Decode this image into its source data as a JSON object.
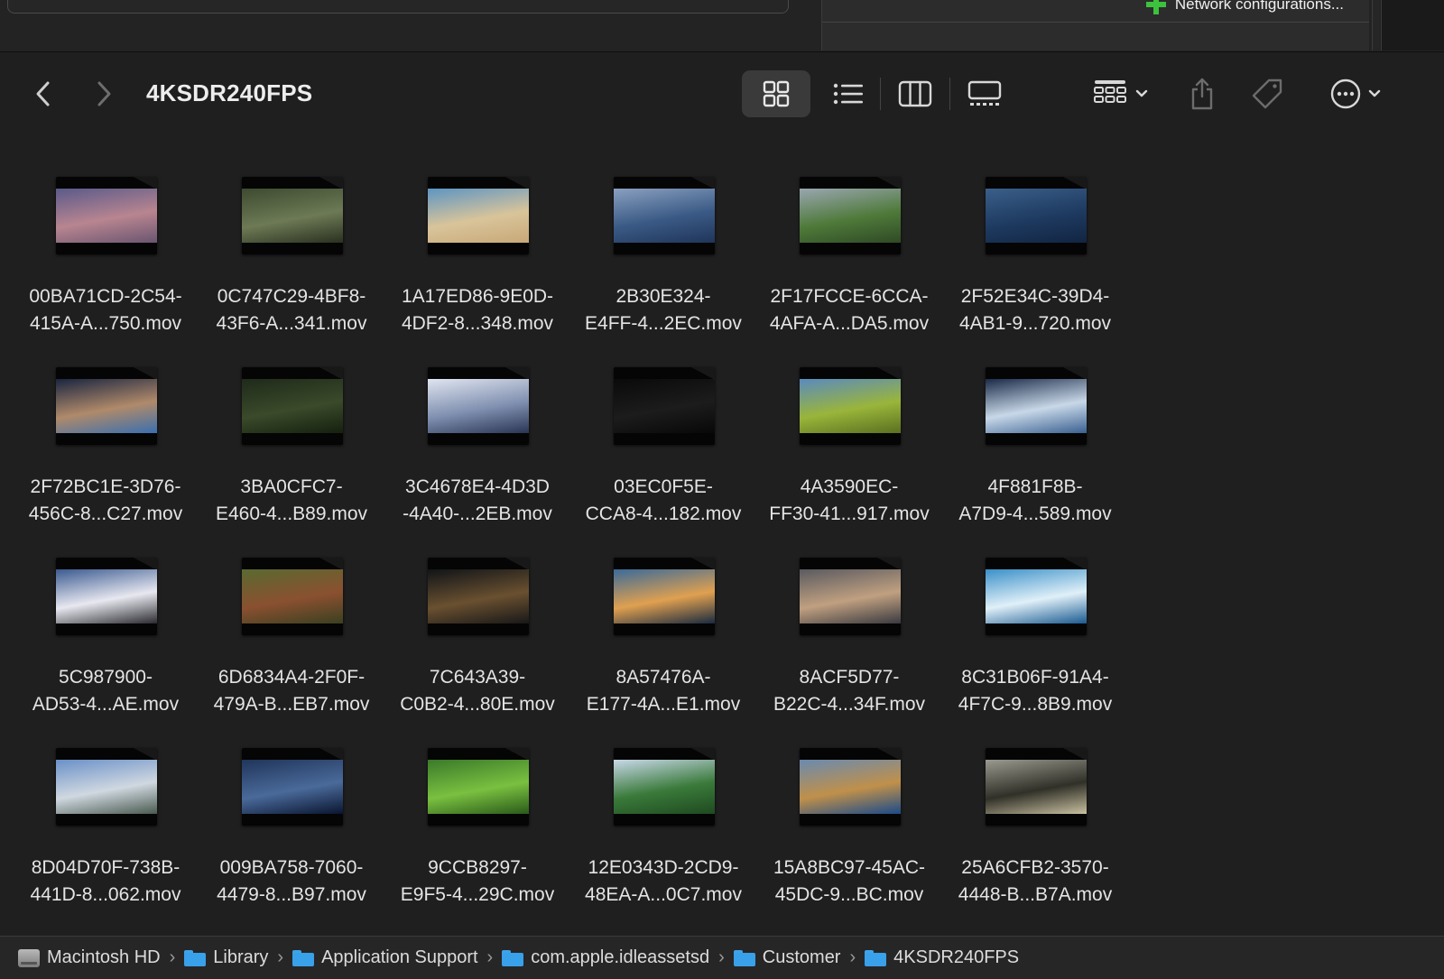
{
  "background_window": {
    "network_label": "Network configurations..."
  },
  "toolbar": {
    "title": "4KSDR240FPS"
  },
  "items": [
    {
      "line1": "00BA71CD-2C54-",
      "line2": "415A-A...750.mov",
      "colors": [
        "#5a5a8a",
        "#b88590",
        "#6a5570"
      ]
    },
    {
      "line1": "0C747C29-4BF8-",
      "line2": "43F6-A...341.mov",
      "colors": [
        "#3d4a30",
        "#6d7a55",
        "#2a3020"
      ]
    },
    {
      "line1": "1A17ED86-9E0D-",
      "line2": "4DF2-8...348.mov",
      "colors": [
        "#5d95c4",
        "#d9c49a",
        "#c8a878"
      ]
    },
    {
      "line1": "2B30E324-",
      "line2": "E4FF-4...2EC.mov",
      "colors": [
        "#8aa0c0",
        "#3a5a85",
        "#20355a"
      ]
    },
    {
      "line1": "2F17FCCE-6CCA-",
      "line2": "4AFA-A...DA5.mov",
      "colors": [
        "#9aa6b0",
        "#4f7a3a",
        "#2f4a25"
      ]
    },
    {
      "line1": "2F52E34C-39D4-",
      "line2": "4AB1-9...720.mov",
      "colors": [
        "#3a5f8a",
        "#1e3a60",
        "#122542"
      ]
    },
    {
      "line1": "2F72BC1E-3D76-",
      "line2": "456C-8...C27.mov",
      "colors": [
        "#1a2540",
        "#b08a6a",
        "#3a6fb0"
      ]
    },
    {
      "line1": "3BA0CFC7-",
      "line2": "E460-4...B89.mov",
      "colors": [
        "#1f2a1a",
        "#3a4a2a",
        "#15200f"
      ]
    },
    {
      "line1": "3C4678E4-4D3D",
      "line2": "-4A40-...2EB.mov",
      "colors": [
        "#e0e5f0",
        "#8090b0",
        "#2a3555"
      ]
    },
    {
      "line1": "03EC0F5E-",
      "line2": "CCA8-4...182.mov",
      "colors": [
        "#0a0a0a",
        "#1c1c1c",
        "#080808"
      ]
    },
    {
      "line1": "4A3590EC-",
      "line2": "FF30-41...917.mov",
      "colors": [
        "#5a8ac0",
        "#9ab53a",
        "#5a7020"
      ]
    },
    {
      "line1": "4F881F8B-",
      "line2": "A7D9-4...589.mov",
      "colors": [
        "#1a2a48",
        "#c8d8e8",
        "#3a6090"
      ]
    },
    {
      "line1": "5C987900-",
      "line2": "AD53-4...AE.mov",
      "colors": [
        "#3a5a90",
        "#e8e8f0",
        "#2a2a30"
      ]
    },
    {
      "line1": "6D6834A4-2F0F-",
      "line2": "479A-B...EB7.mov",
      "colors": [
        "#5a6a30",
        "#8a5030",
        "#3a4020"
      ]
    },
    {
      "line1": "7C643A39-",
      "line2": "C0B2-4...80E.mov",
      "colors": [
        "#101418",
        "#6a5030",
        "#181818"
      ]
    },
    {
      "line1": "8A57476A-",
      "line2": "E177-4A...E1.mov",
      "colors": [
        "#3a6a9a",
        "#e0a050",
        "#1a2a40"
      ]
    },
    {
      "line1": "8ACF5D77-",
      "line2": "B22C-4...34F.mov",
      "colors": [
        "#5a5a60",
        "#c0a080",
        "#3a3a40"
      ]
    },
    {
      "line1": "8C31B06F-91A4-",
      "line2": "4F7C-9...8B9.mov",
      "colors": [
        "#3a90c8",
        "#e0f0f8",
        "#1a5a90"
      ]
    },
    {
      "line1": "8D04D70F-738B-",
      "line2": "441D-8...062.mov",
      "colors": [
        "#6a90c8",
        "#d0d8e0",
        "#4a5a50"
      ]
    },
    {
      "line1": "009BA758-7060-",
      "line2": "4479-8...B97.mov",
      "colors": [
        "#20355a",
        "#4a6a9a",
        "#0a1530"
      ]
    },
    {
      "line1": "9CCB8297-",
      "line2": "E9F5-4...29C.mov",
      "colors": [
        "#3a7a2a",
        "#7ac040",
        "#2a5a1a"
      ]
    },
    {
      "line1": "12E0343D-2CD9-",
      "line2": "48EA-A...0C7.mov",
      "colors": [
        "#c8d8e8",
        "#3a7a3a",
        "#1f4a20"
      ]
    },
    {
      "line1": "15A8BC97-45AC-",
      "line2": "45DC-9...BC.mov",
      "colors": [
        "#6a8ab0",
        "#c0904a",
        "#1a4a8a"
      ]
    },
    {
      "line1": "25A6CFB2-3570-",
      "line2": "4448-B...B7A.mov",
      "colors": [
        "#9a9a90",
        "#303028",
        "#c8c0a0"
      ]
    }
  ],
  "path": [
    "Macintosh HD",
    "Library",
    "Application Support",
    "com.apple.idleassetsd",
    "Customer",
    "4KSDR240FPS"
  ],
  "icons": {
    "back": "chevron-left-icon",
    "forward": "chevron-right-icon",
    "view_icons": "grid-view-icon",
    "view_list": "list-view-icon",
    "view_columns": "column-view-icon",
    "view_gallery": "gallery-view-icon",
    "group": "group-by-icon",
    "share": "share-icon",
    "tag": "tag-icon",
    "more": "more-icon"
  }
}
